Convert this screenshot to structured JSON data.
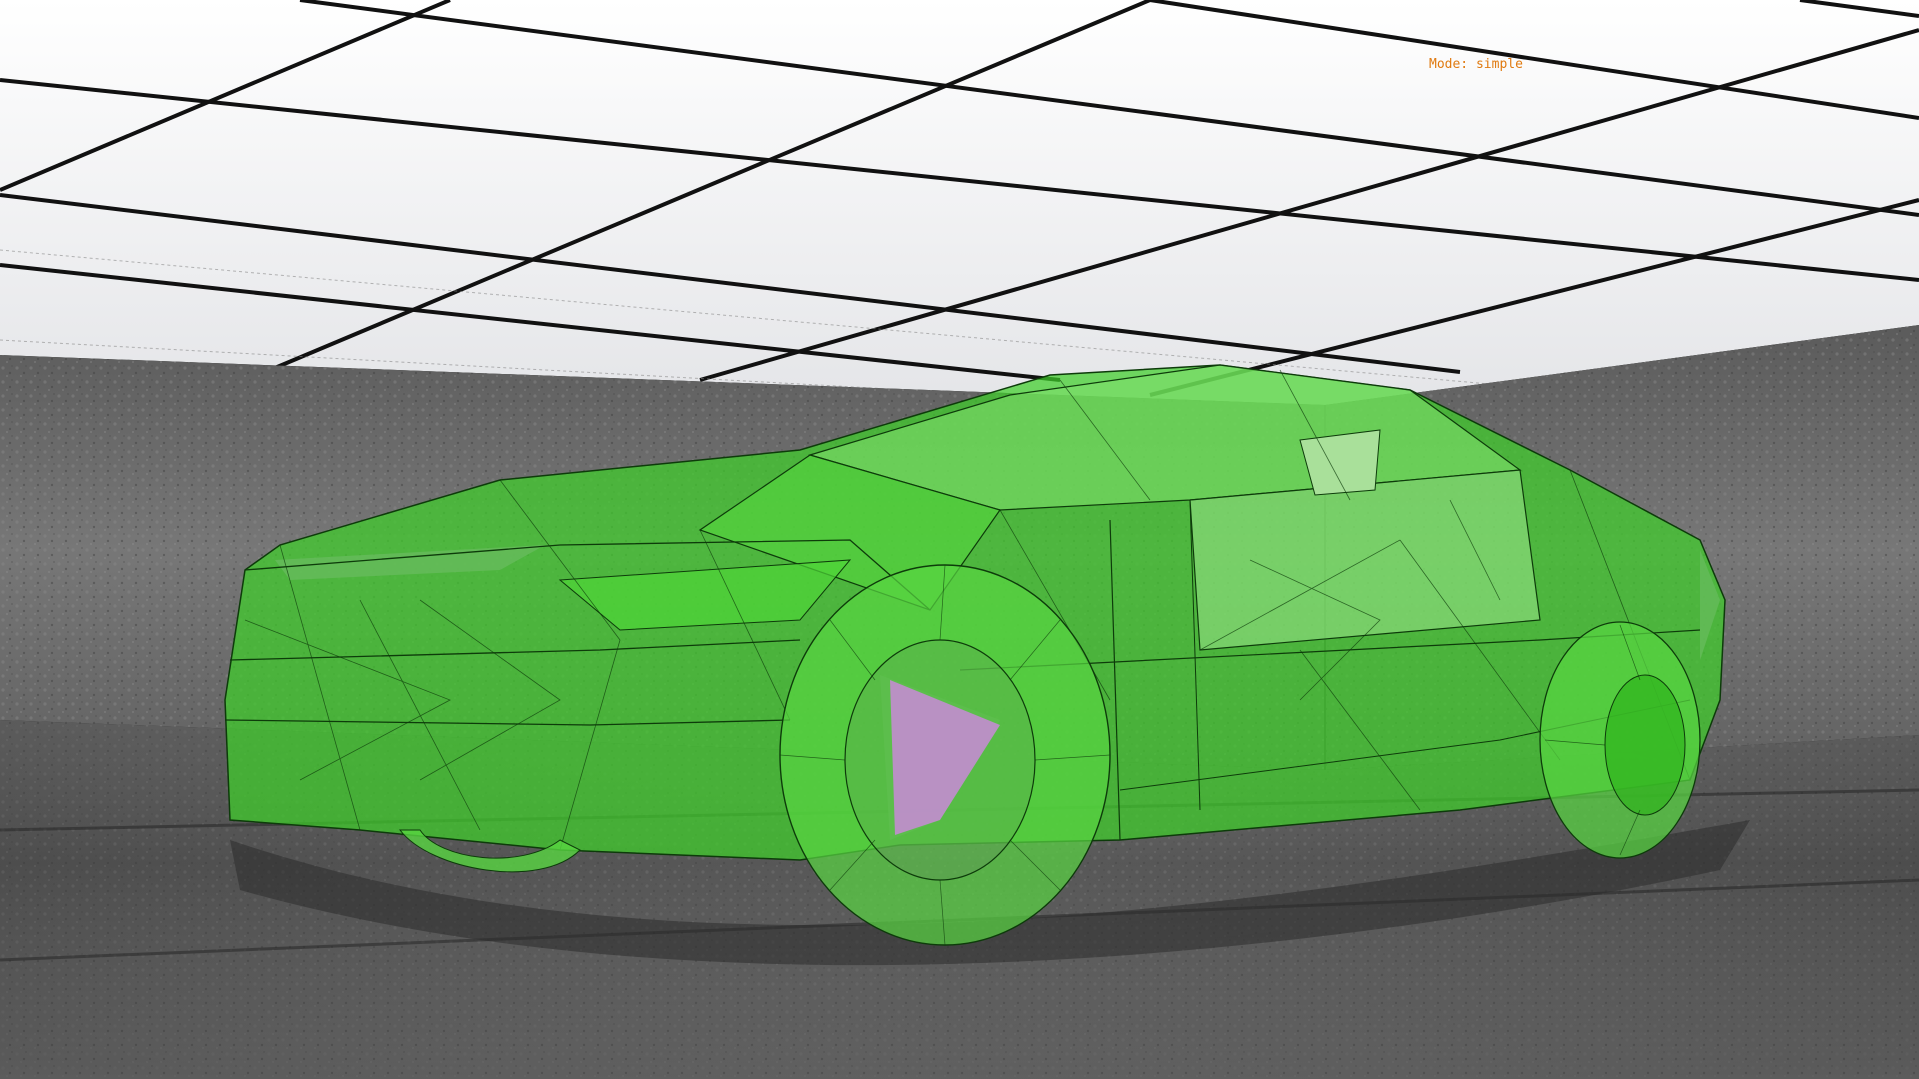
{
  "viewport": {
    "mode_label": "Mode: simple"
  },
  "colors": {
    "ceiling_panel": "#f2f3f5",
    "ceiling_grid": "#111111",
    "wall": "#6c6c6c",
    "floor": "#5a5a5a",
    "car_mesh": "#3fcf2a",
    "car_edge": "#0d3b0a",
    "interior_highlight": "#c98ad8",
    "mode_label": "#e07a10"
  },
  "icons": {
    "scene_object": "car-wireframe-mesh"
  }
}
